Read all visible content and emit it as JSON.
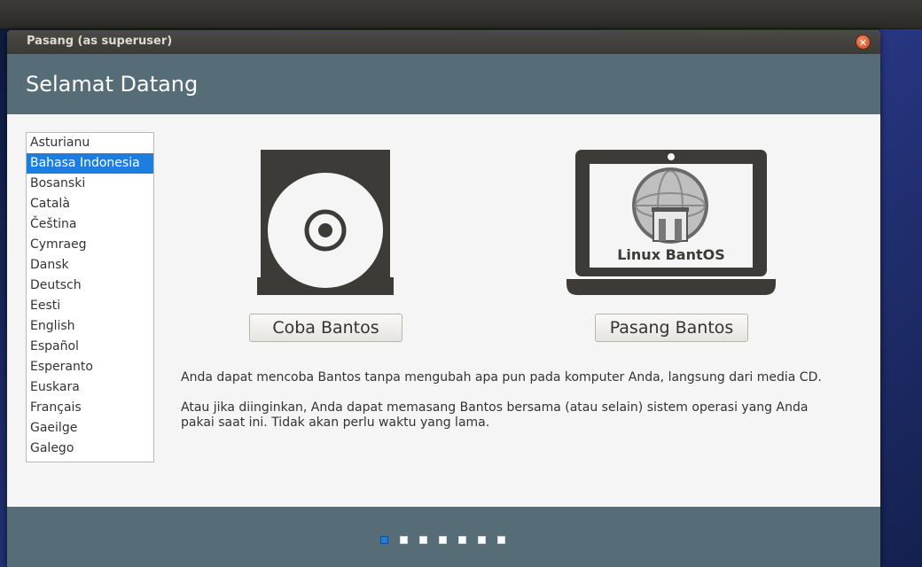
{
  "window": {
    "title": "Pasang (as superuser)"
  },
  "header": {
    "title": "Selamat Datang"
  },
  "languages": {
    "items": [
      "Asturianu",
      "Bahasa Indonesia",
      "Bosanski",
      "Català",
      "Čeština",
      "Cymraeg",
      "Dansk",
      "Deutsch",
      "Eesti",
      "English",
      "Español",
      "Esperanto",
      "Euskara",
      "Français",
      "Gaeilge",
      "Galego"
    ],
    "selected": "Bahasa Indonesia"
  },
  "try_option": {
    "button_label": "Coba Bantos"
  },
  "install_option": {
    "button_label": "Pasang Bantos",
    "logo_text": "Linux BantOS"
  },
  "description": {
    "line1": "Anda dapat mencoba Bantos tanpa mengubah apa pun pada komputer Anda, langsung dari media CD.",
    "line2": "Atau jika diinginkan, Anda dapat memasang Bantos bersama (atau selain) sistem operasi yang Anda pakai saat ini. Tidak akan perlu waktu yang lama."
  },
  "progress": {
    "total_steps": 7,
    "current_step": 1
  },
  "colors": {
    "header_bg": "#566d78",
    "selection": "#1b7ee0",
    "close_button": "#e0582e"
  }
}
